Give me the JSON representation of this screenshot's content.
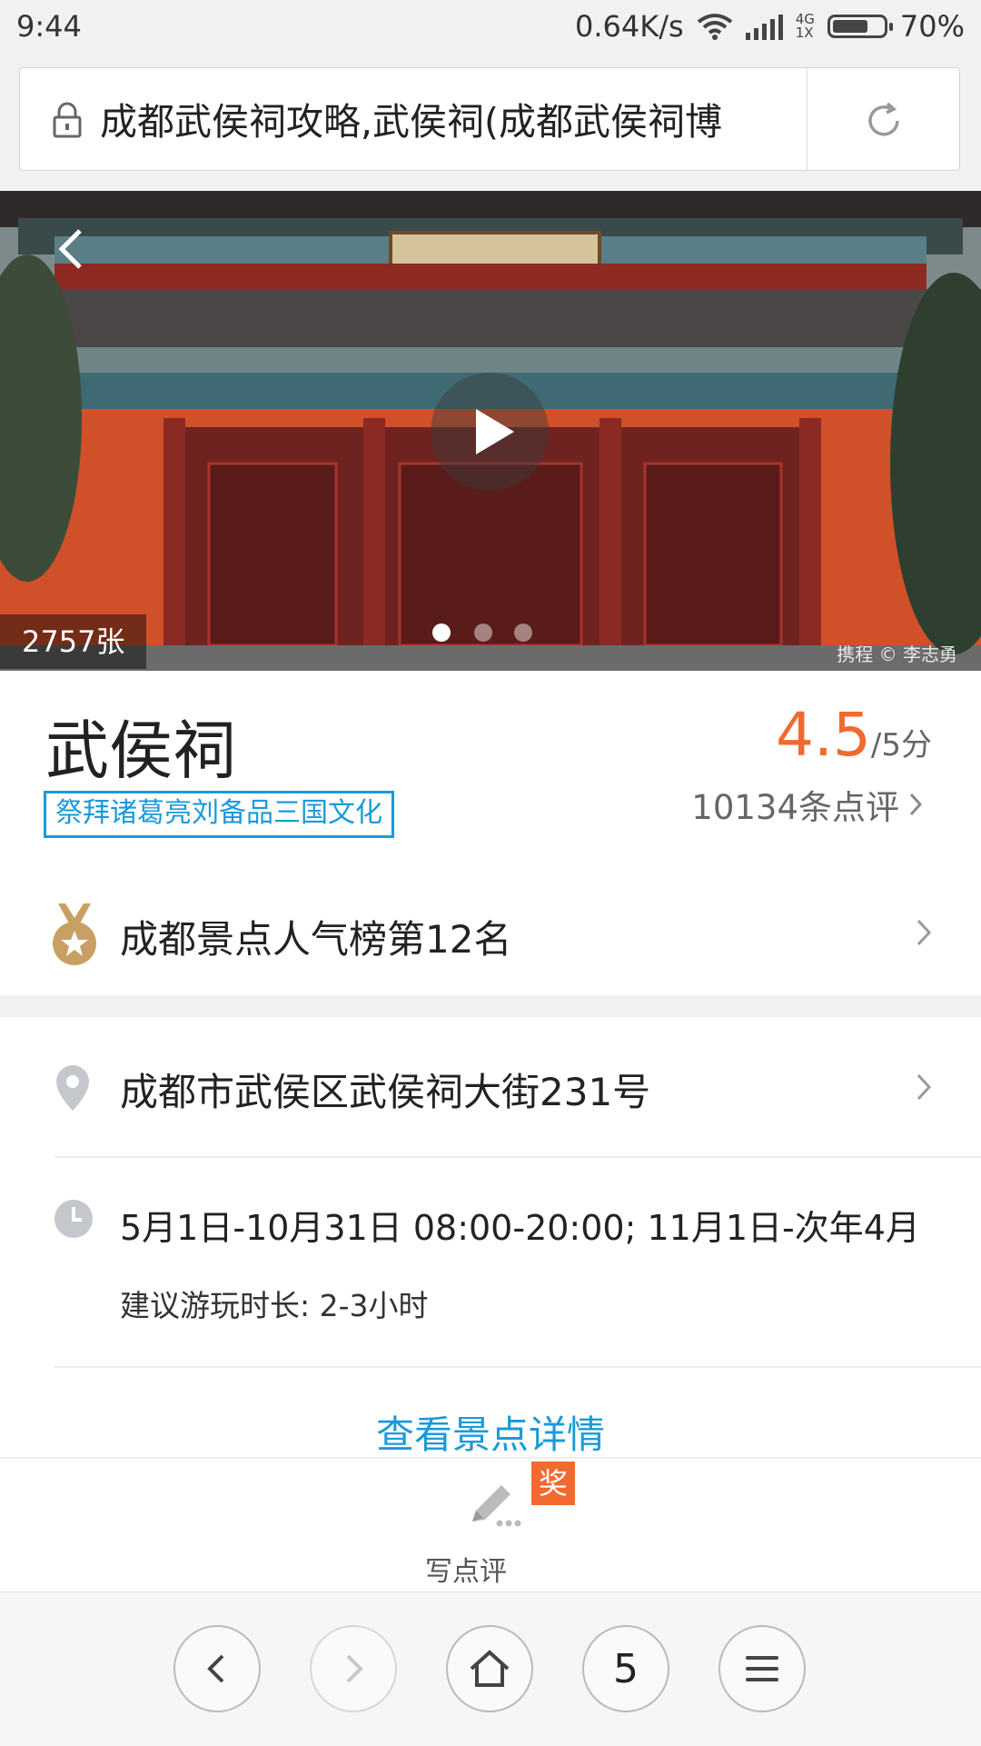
{
  "status_bar": {
    "time": "9:44",
    "net_speed": "0.64K/s",
    "net_type_top": "4G",
    "net_type_bottom": "1X",
    "battery": "70%",
    "battery_level": 0.7
  },
  "address_bar": {
    "url_text": "成都武侯祠攻略,武侯祠(成都武侯祠博",
    "lock_icon": "lock-icon",
    "refresh_icon": "refresh-icon"
  },
  "hero": {
    "photo_count": "2757张",
    "watermark": "携程 © 李志勇",
    "carousel_index": 1,
    "carousel_total": 3
  },
  "poi": {
    "title": "武侯祠",
    "tag": "祭拜诸葛亮刘备品三国文化",
    "rating": "4.5",
    "rating_unit": "/5分",
    "review_count": "10134条点评"
  },
  "rank": {
    "text": "成都景点人气榜第12名",
    "icon": "medal-icon"
  },
  "address": {
    "text": "成都市武侯区武侯祠大街231号",
    "icon": "location-pin-icon"
  },
  "hours": {
    "text": "5月1日-10月31日 08:00-20:00; 11月1日-次年4月...",
    "duration": "建议游玩时长: 2-3小时",
    "icon": "clock-icon"
  },
  "detail_link": "查看景点详情",
  "review_bar": {
    "label": "写点评",
    "badge": "奖",
    "icon": "pen-icon"
  },
  "browser_nav": {
    "tab_count": "5"
  },
  "colors": {
    "accent_orange": "#f06a2e",
    "link_blue": "#1b9ad8",
    "badge_orange": "#f26a30"
  }
}
